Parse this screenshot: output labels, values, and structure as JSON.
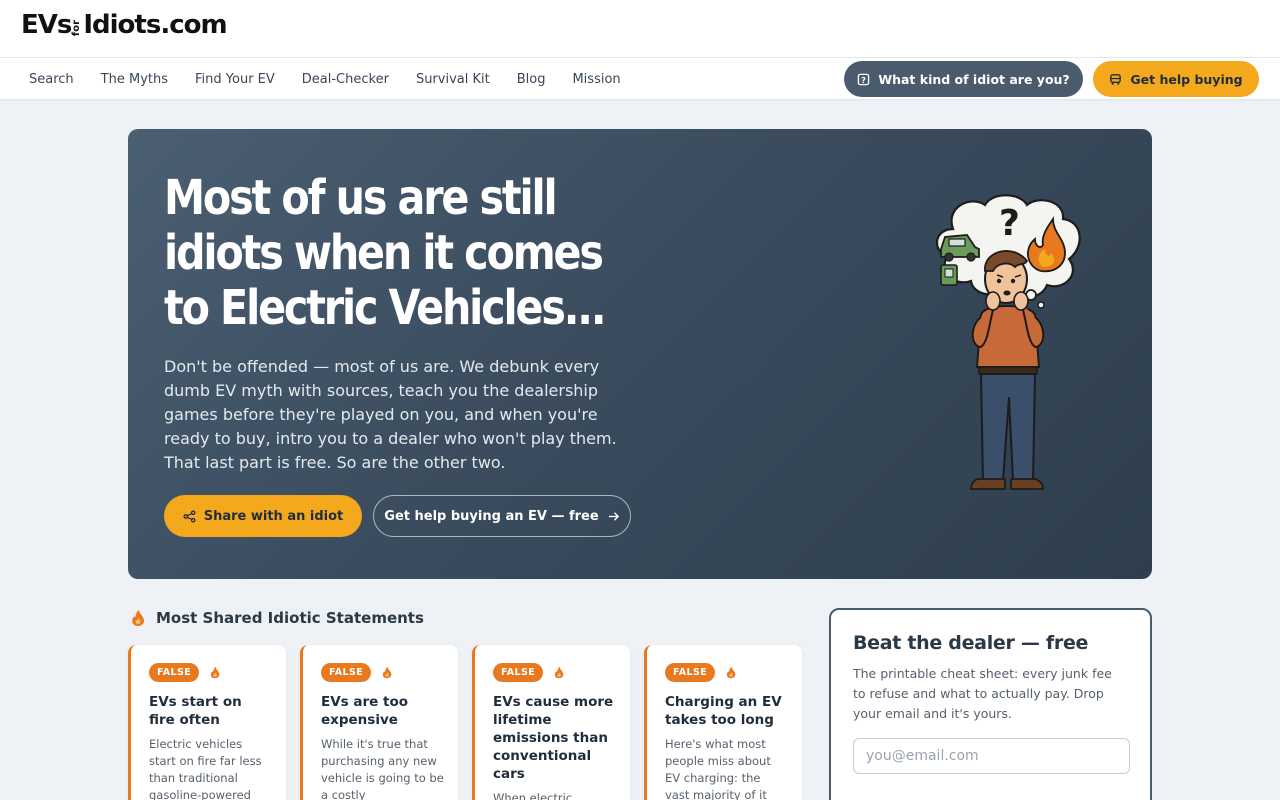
{
  "header": {
    "logo_ev": "EVs",
    "logo_for": "for",
    "logo_idiots": "Idiots.com"
  },
  "nav": {
    "items": [
      "Search",
      "The Myths",
      "Find Your EV",
      "Deal-Checker",
      "Survival Kit",
      "Blog",
      "Mission"
    ],
    "quiz_button": "What kind of idiot are you?",
    "buy_button": "Get help buying"
  },
  "hero": {
    "title": "Most of us are still idiots when it comes to Electric Vehicles...",
    "text": "Don't be offended — most of us are. We debunk every dumb EV myth with sources, teach you the dealership games before they're played on you, and when you're ready to buy, intro you to a dealer who won't play them. That last part is free. So are the other two.",
    "share_button": "Share with an idiot",
    "help_button": "Get help buying an EV — free"
  },
  "statements": {
    "title": "Most Shared Idiotic Statements",
    "cards": [
      {
        "badge": "FALSE",
        "title": "EVs start on fire often",
        "text": "Electric vehicles start on fire far less than traditional gasoline-powered"
      },
      {
        "badge": "FALSE",
        "title": "EVs are too expensive",
        "text": "While it's true that purchasing any new vehicle is going to be a costly"
      },
      {
        "badge": "FALSE",
        "title": "EVs cause more lifetime emissions than conventional cars",
        "text": "When electric"
      },
      {
        "badge": "FALSE",
        "title": "Charging an EV takes too long",
        "text": "Here's what most people miss about EV charging: the vast majority of it"
      }
    ]
  },
  "dealer": {
    "title": "Beat the dealer — free",
    "text": "The printable cheat sheet: every junk fee to refuse and what to actually pay. Drop your email and it's yours.",
    "email_placeholder": "you@email.com"
  },
  "colors": {
    "accent": "#f4a81b",
    "false_badge": "#e8791e",
    "hero_bg": "#3a4c5e",
    "quiz_button": "#4a5b6d"
  }
}
